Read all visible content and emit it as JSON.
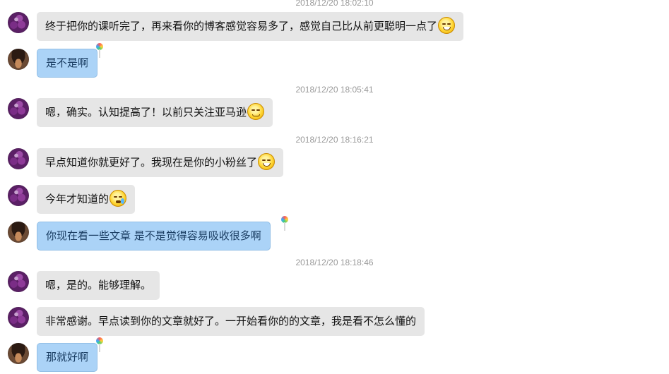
{
  "timestamps": [
    "2018/12/20 18:02:10",
    "2018/12/20 18:05:41",
    "2018/12/20 18:16:21",
    "2018/12/20 18:18:46"
  ],
  "messages": [
    {
      "sender": "other",
      "text": "终于把你的课听完了，再来看你的博客感觉容易多了，感觉自己比从前更聪明一点了",
      "emoji": "grin-icon"
    },
    {
      "sender": "self",
      "text": "是不是啊"
    },
    {
      "sender": "other",
      "text": "嗯，确实。认知提高了！以前只关注亚马逊",
      "emoji": "smug-face-icon"
    },
    {
      "sender": "other",
      "text": "早点知道你就更好了。我现在是你的小粉丝了",
      "emoji": "grin-icon"
    },
    {
      "sender": "other",
      "text": "今年才知道的",
      "emoji": "crying-face-icon"
    },
    {
      "sender": "self",
      "text": "你现在看一些文章 是不是觉得容易吸收很多啊"
    },
    {
      "sender": "other",
      "text": "嗯，是的。能够理解。"
    },
    {
      "sender": "other",
      "text": "非常感谢。早点读到你的文章就好了。一开始看你的的文章，我是看不怎么懂的"
    },
    {
      "sender": "self",
      "text": "那就好啊"
    }
  ],
  "colors": {
    "incoming_bubble": "#e6e6e6",
    "outgoing_bubble": "#abd3f7",
    "timestamp_text": "#9a9a9a"
  }
}
